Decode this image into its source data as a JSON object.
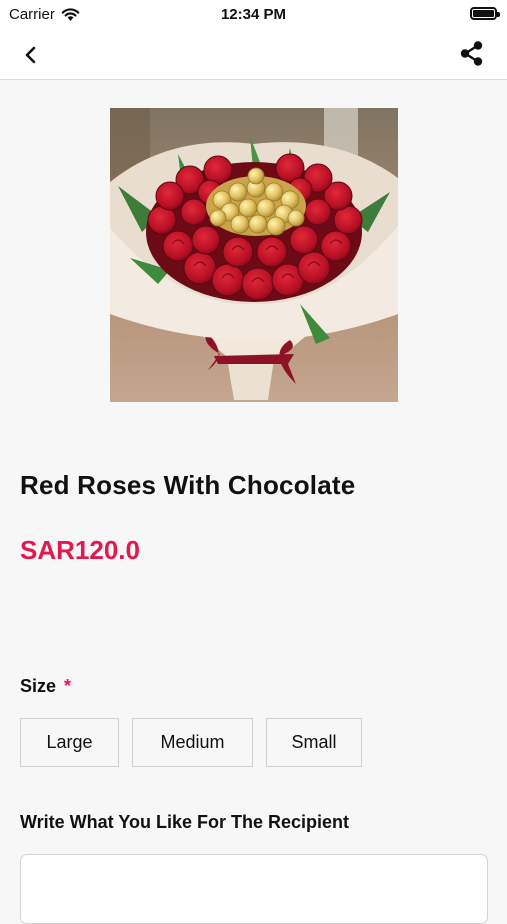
{
  "status_bar": {
    "carrier": "Carrier",
    "time": "12:34 PM"
  },
  "product": {
    "name": "Red Roses With Chocolate",
    "price": "SAR120.0",
    "image_alt": "Bouquet of red roses with chocolates"
  },
  "size": {
    "label": "Size",
    "required_mark": "*",
    "options": [
      "Large",
      "Medium",
      "Small"
    ]
  },
  "recipient": {
    "label": "Write What You Like For The Recipient",
    "placeholder": ""
  },
  "colors": {
    "accent": "#e0194e",
    "background": "#f7f7f7",
    "border": "#cfcfcf"
  },
  "icons": {
    "back": "chevron-left-icon",
    "share": "share-icon",
    "wifi": "wifi-icon",
    "battery": "battery-icon"
  }
}
